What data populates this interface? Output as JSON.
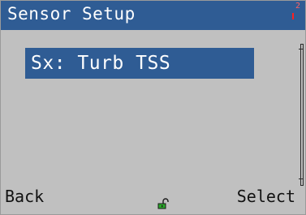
{
  "header": {
    "title": "Sensor Setup",
    "indicator_number": "2"
  },
  "menu": {
    "items": [
      {
        "label": "Sx: Turb TSS",
        "selected": true
      }
    ]
  },
  "softkeys": {
    "left_label": "Back",
    "right_label": "Select"
  },
  "status_icons": {
    "lock": "unlocked-padlock-icon"
  },
  "colors": {
    "title_bar": "#2f5c94",
    "highlight": "#2f5c94",
    "background": "#c0c0c0",
    "lock_green": "#2aa52a",
    "indicator_red": "#ff2020"
  }
}
